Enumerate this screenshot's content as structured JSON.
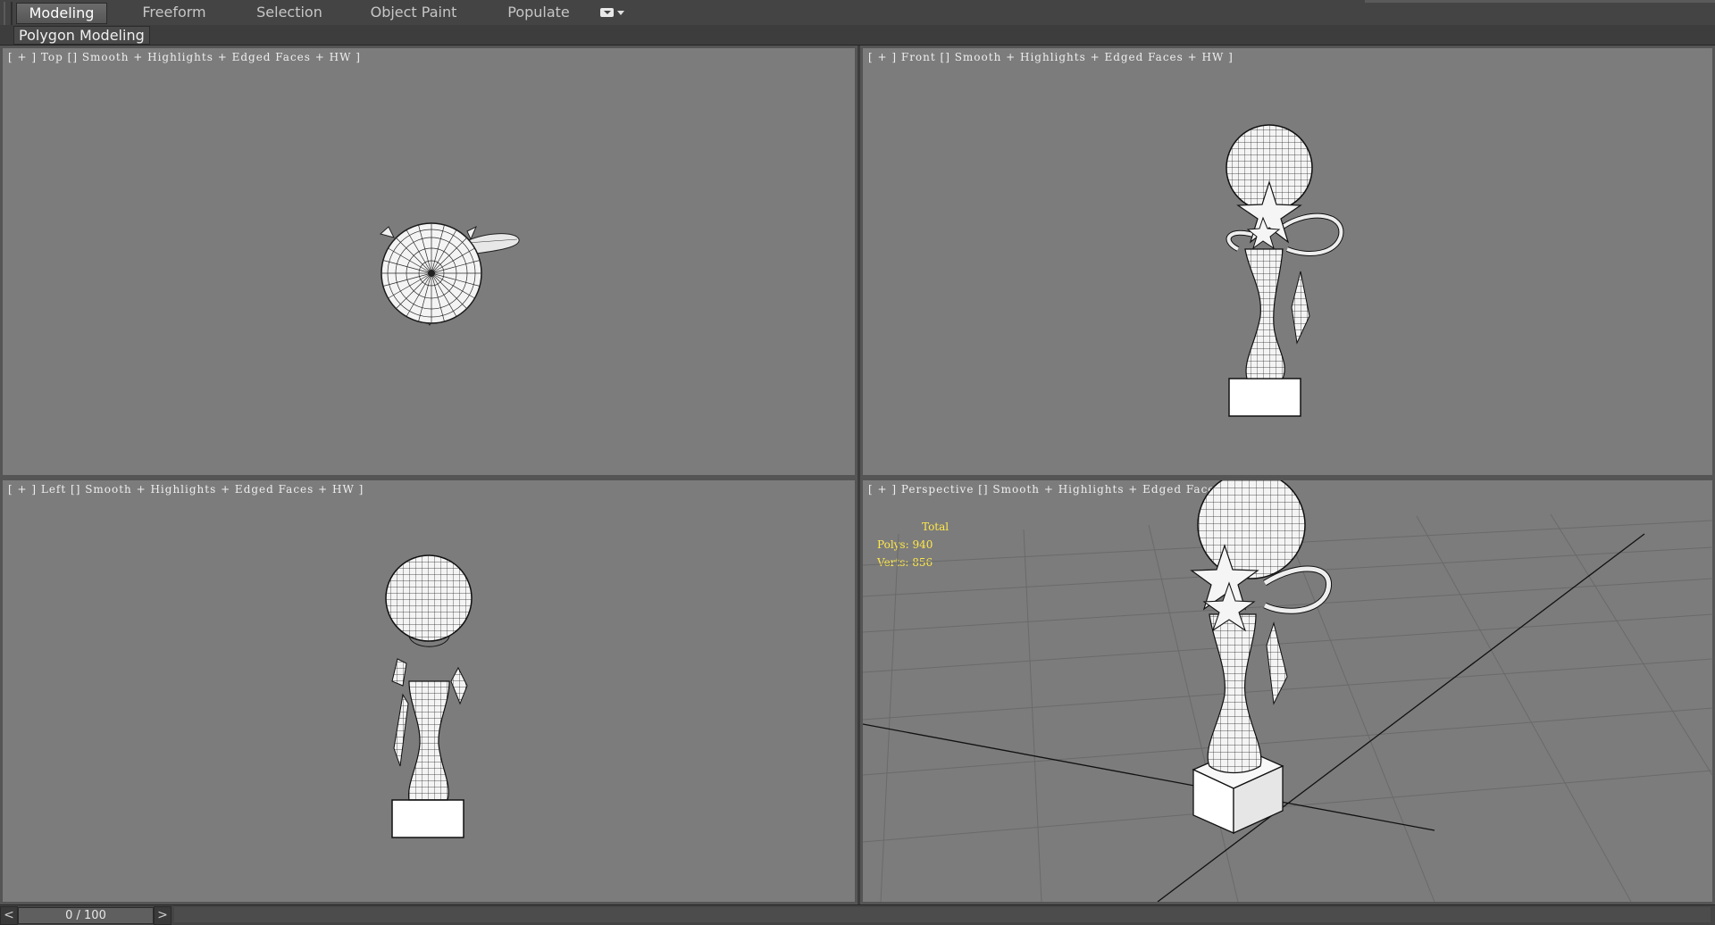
{
  "ribbon": {
    "tabs": [
      {
        "label": "Modeling",
        "active": true
      },
      {
        "label": "Freeform",
        "active": false
      },
      {
        "label": "Selection",
        "active": false
      },
      {
        "label": "Object Paint",
        "active": false
      },
      {
        "label": "Populate",
        "active": false
      }
    ],
    "panel_label": "Polygon Modeling",
    "toggle_icon": "ribbon-toggle-icon"
  },
  "viewports": {
    "top": {
      "label": "[ + ] Top [] Smooth + Highlights + Edged Faces + HW ]"
    },
    "front": {
      "label": "[ + ] Front [] Smooth + Highlights + Edged Faces + HW ]"
    },
    "left": {
      "label": "[ + ] Left [] Smooth + Highlights + Edged Faces + HW ]"
    },
    "perspective": {
      "label": "[ + ] Perspective [] Smooth + Highlights + Edged Faces + HW ]",
      "stats": {
        "total": "Total",
        "polys": "Polys: 940",
        "verts": "Verts: 856"
      }
    }
  },
  "timeline": {
    "prev": "<",
    "slider_text": "0 / 100",
    "next": ">"
  },
  "colors": {
    "viewport_bg": "#7c7c7c",
    "stats_text": "#ffe84a",
    "ui_dark": "#444444"
  }
}
